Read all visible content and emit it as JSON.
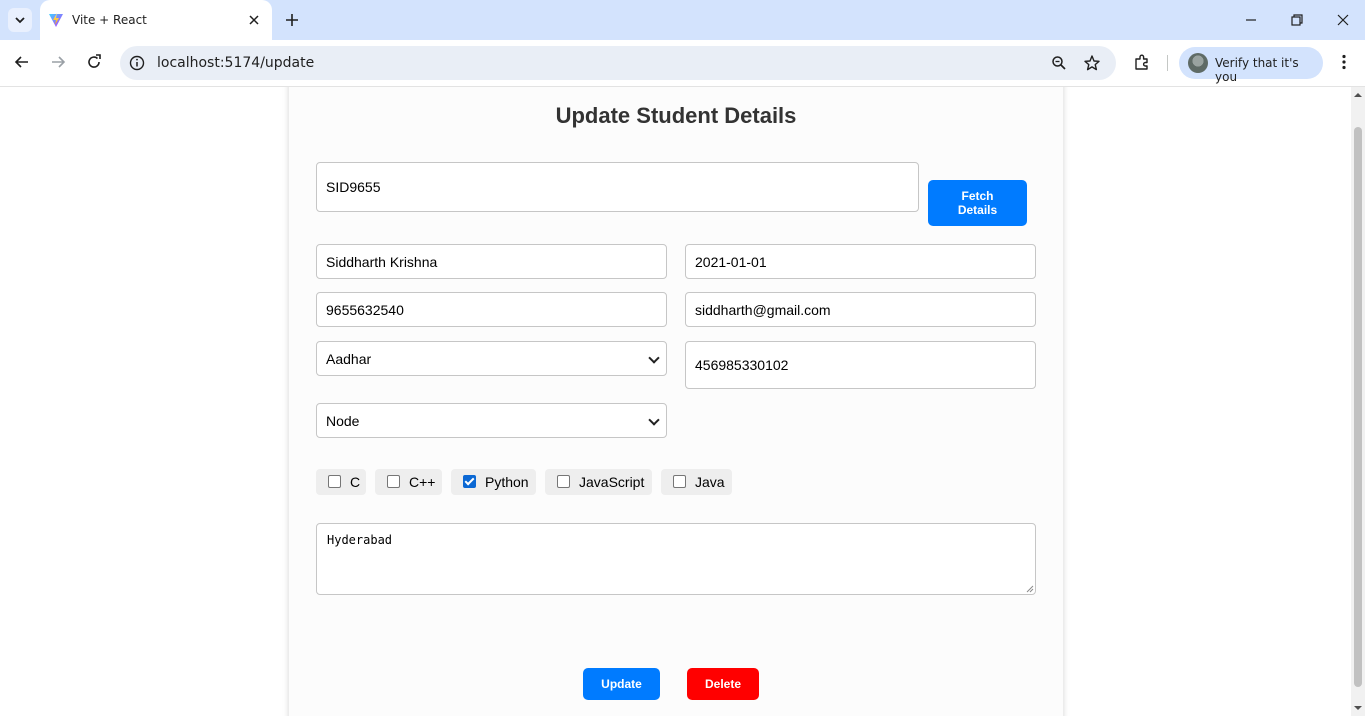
{
  "browser": {
    "tab_title": "Vite + React",
    "url": "localhost:5174/update",
    "profile_label": "Verify that it's you"
  },
  "page": {
    "heading": "Update Student Details",
    "student_id": "SID9655",
    "fetch_label": "Fetch Details",
    "name": "Siddharth Krishna",
    "dob": "2021-01-01",
    "phone": "9655632540",
    "email": "siddharth@gmail.com",
    "id_type": "Aadhar",
    "id_number": "456985330102",
    "course": "Node",
    "skills": [
      {
        "label": "C",
        "checked": false
      },
      {
        "label": "C++",
        "checked": false
      },
      {
        "label": "Python",
        "checked": true
      },
      {
        "label": "JavaScript",
        "checked": false
      },
      {
        "label": "Java",
        "checked": false
      }
    ],
    "address": "Hyderabad",
    "update_label": "Update",
    "delete_label": "Delete"
  },
  "colors": {
    "primary": "#007bff",
    "danger": "#ff0000",
    "chrome_tabstrip": "#d3e3fd",
    "checkbox_checked": "#0b68d4"
  },
  "icons": [
    "tab-search-icon",
    "vite-logo-icon",
    "close-icon",
    "plus-icon",
    "minimize-icon",
    "restore-icon",
    "window-close-icon",
    "back-icon",
    "forward-icon",
    "reload-icon",
    "site-info-icon",
    "zoom-icon",
    "star-icon",
    "extensions-icon",
    "kebab-menu-icon"
  ]
}
